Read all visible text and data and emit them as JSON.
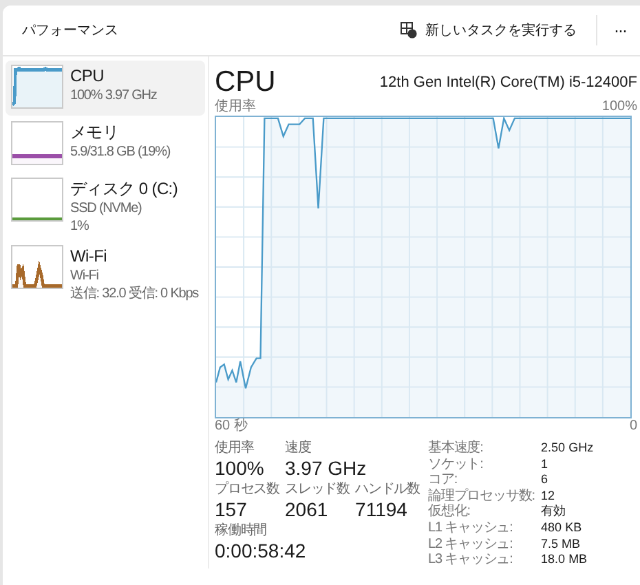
{
  "header": {
    "title": "パフォーマンス",
    "run_task": "新しいタスクを実行する",
    "more": "···"
  },
  "sidebar": {
    "items": [
      {
        "kind": "cpu",
        "name": "CPU",
        "lines": [
          "100%  3.97 GHz"
        ],
        "color": "#4a9bc9",
        "selected": true
      },
      {
        "kind": "memory",
        "name": "メモリ",
        "lines": [
          "5.9/31.8 GB (19%)"
        ],
        "color": "#9b4fa8",
        "selected": false
      },
      {
        "kind": "disk",
        "name": "ディスク 0 (C:)",
        "lines": [
          "SSD (NVMe)",
          "1%"
        ],
        "color": "#5a9b3c",
        "selected": false
      },
      {
        "kind": "network",
        "name": "Wi-Fi",
        "lines": [
          "Wi-Fi",
          "送信: 32.0  受信: 0 Kbps"
        ],
        "color": "#a7692a",
        "selected": false
      }
    ]
  },
  "main": {
    "title": "CPU",
    "model": "12th Gen Intel(R) Core(TM) i5-12400F",
    "y_label": "使用率",
    "y_max": "100%",
    "x_start": "60 秒",
    "x_end": "0",
    "stats": [
      [
        {
          "label": "使用率",
          "value": "100%"
        },
        {
          "label": "速度",
          "value": "3.97 GHz"
        }
      ],
      [
        {
          "label": "プロセス数",
          "value": "157"
        },
        {
          "label": "スレッド数",
          "value": "2061"
        },
        {
          "label": "ハンドル数",
          "value": "71194"
        }
      ],
      [
        {
          "label": "稼働時間",
          "value": "0:00:58:42"
        }
      ]
    ],
    "specs": [
      {
        "label": "基本速度:",
        "value": "2.50 GHz"
      },
      {
        "label": "ソケット:",
        "value": "1"
      },
      {
        "label": "コア:",
        "value": "6"
      },
      {
        "label": "論理プロセッサ数:",
        "value": "12"
      },
      {
        "label": "仮想化:",
        "value": "有効"
      },
      {
        "label": "L1 キャッシュ:",
        "value": "480 KB"
      },
      {
        "label": "L2 キャッシュ:",
        "value": "7.5 MB"
      },
      {
        "label": "L3 キャッシュ:",
        "value": "18.0 MB"
      }
    ]
  }
}
